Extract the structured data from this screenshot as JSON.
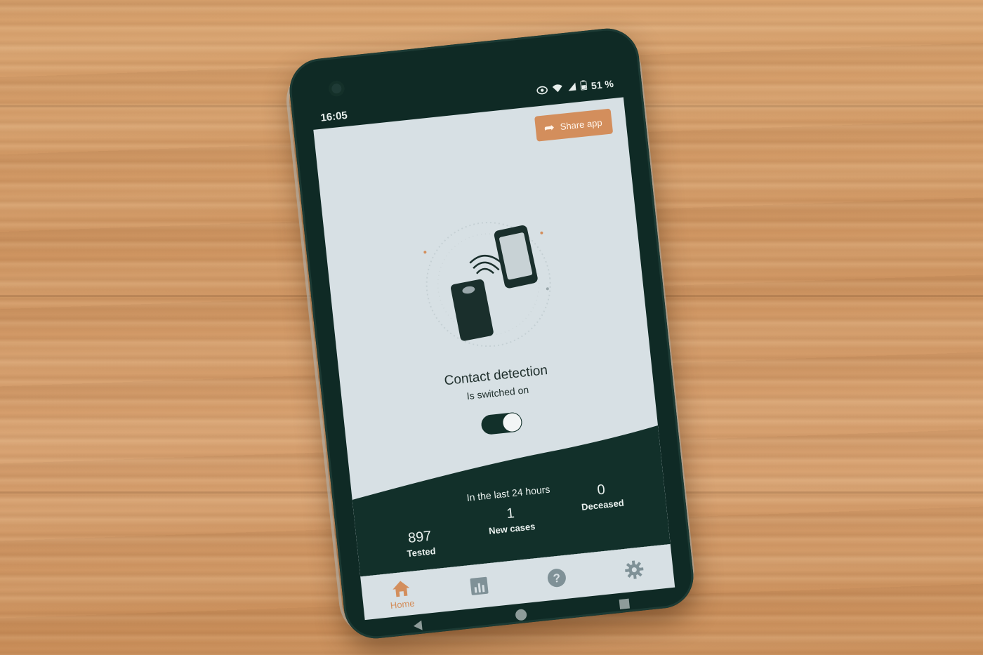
{
  "status_bar": {
    "time": "16:05",
    "battery": "51 %"
  },
  "header": {
    "share_label": "Share app"
  },
  "detection": {
    "title": "Contact detection",
    "subtitle": "Is switched on",
    "toggle_on": true
  },
  "stats": {
    "header": "In the last 24 hours",
    "tested": {
      "value": "897",
      "label": "Tested"
    },
    "new_cases": {
      "value": "1",
      "label": "New cases"
    },
    "deceased": {
      "value": "0",
      "label": "Deceased"
    }
  },
  "nav": {
    "items": [
      {
        "label": "Home",
        "icon": "home-icon",
        "active": true
      },
      {
        "label": "",
        "icon": "chart-icon",
        "active": false
      },
      {
        "label": "",
        "icon": "help-icon",
        "active": false
      },
      {
        "label": "",
        "icon": "gear-icon",
        "active": false
      }
    ]
  },
  "colors": {
    "accent": "#d38e5c",
    "dark": "#12302a",
    "screen": "#d7e0e4"
  }
}
